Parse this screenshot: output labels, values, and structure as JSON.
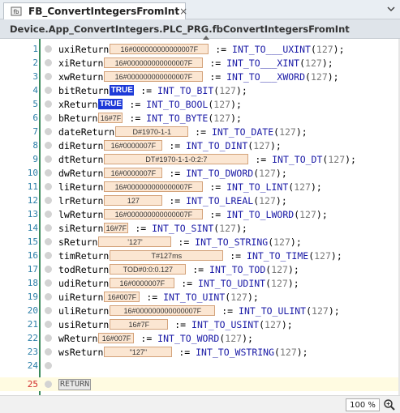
{
  "tab": {
    "title": "FB_ConvertIntegersFromInt",
    "close": "×"
  },
  "path": {
    "title": "Device.App_ConvertIntegers.PLC_PRG.fbConvertIntegersFromInt"
  },
  "lines": [
    {
      "num": "1",
      "var": "uxiReturn",
      "value": "16#000000000000007F",
      "w": 122,
      "func": "INT_TO___UXINT",
      "arg": "127"
    },
    {
      "num": "2",
      "var": "xiReturn",
      "value": "16#000000000000007F",
      "w": 122,
      "func": "INT_TO___XINT",
      "arg": "127"
    },
    {
      "num": "3",
      "var": "xwReturn",
      "value": "16#000000000000007F",
      "w": 122,
      "func": "INT_TO___XWORD",
      "arg": "127"
    },
    {
      "num": "4",
      "var": "bitReturn",
      "value": "TRUE",
      "w": 30,
      "bool": true,
      "func": "INT_TO_BIT",
      "arg": "127"
    },
    {
      "num": "5",
      "var": "xReturn",
      "value": "TRUE",
      "w": 30,
      "bool": true,
      "func": "INT_TO_BOOL",
      "arg": "127"
    },
    {
      "num": "6",
      "var": "bReturn",
      "value": "16#7F",
      "w": 30,
      "func": "INT_TO_BYTE",
      "arg": "127"
    },
    {
      "num": "7",
      "var": "dateReturn",
      "value": "D#1970-1-1",
      "w": 90,
      "func": "INT_TO_DATE",
      "arg": "127"
    },
    {
      "num": "8",
      "var": "diReturn",
      "value": "16#0000007F",
      "w": 72,
      "func": "INT_TO_DINT",
      "arg": "127"
    },
    {
      "num": "9",
      "var": "dtReturn",
      "value": "DT#1970-1-1-0:2:7",
      "w": 178,
      "func": "INT_TO_DT",
      "arg": "127"
    },
    {
      "num": "10",
      "var": "dwReturn",
      "value": "16#0000007F",
      "w": 72,
      "func": "INT_TO_DWORD",
      "arg": "127"
    },
    {
      "num": "11",
      "var": "liReturn",
      "value": "16#000000000000007F",
      "w": 122,
      "func": "INT_TO_LINT",
      "arg": "127"
    },
    {
      "num": "12",
      "var": "lrReturn",
      "value": "127",
      "w": 72,
      "func": "INT_TO_LREAL",
      "arg": "127"
    },
    {
      "num": "13",
      "var": "lwReturn",
      "value": "16#000000000000007F",
      "w": 122,
      "func": "INT_TO_LWORD",
      "arg": "127"
    },
    {
      "num": "14",
      "var": "siReturn",
      "value": "16#7F",
      "w": 30,
      "func": "INT_TO_SINT",
      "arg": "127"
    },
    {
      "num": "15",
      "var": "sReturn",
      "value": "'127'",
      "w": 90,
      "func": "INT_TO_STRING",
      "arg": "127"
    },
    {
      "num": "16",
      "var": "timReturn",
      "value": "T#127ms",
      "w": 140,
      "func": "INT_TO_TIME",
      "arg": "127"
    },
    {
      "num": "17",
      "var": "todReturn",
      "value": "TOD#0:0:0.127",
      "w": 94,
      "func": "INT_TO_TOD",
      "arg": "127"
    },
    {
      "num": "18",
      "var": "udiReturn",
      "value": "16#0000007F",
      "w": 80,
      "func": "INT_TO_UDINT",
      "arg": "127"
    },
    {
      "num": "19",
      "var": "uiReturn",
      "value": "16#007F",
      "w": 44,
      "func": "INT_TO_UINT",
      "arg": "127"
    },
    {
      "num": "20",
      "var": "uliReturn",
      "value": "16#000000000000007F",
      "w": 130,
      "func": "INT_TO_ULINT",
      "arg": "127"
    },
    {
      "num": "21",
      "var": "usiReturn",
      "value": "16#7F",
      "w": 72,
      "func": "INT_TO_USINT",
      "arg": "127"
    },
    {
      "num": "22",
      "var": "wReturn",
      "value": "16#007F",
      "w": 44,
      "func": "INT_TO_WORD",
      "arg": "127"
    },
    {
      "num": "23",
      "var": "wsReturn",
      "value": "\"127\"",
      "w": 84,
      "func": "INT_TO_WSTRING",
      "arg": "127"
    }
  ],
  "line24": {
    "num": "24"
  },
  "line25": {
    "num": "25",
    "text": "RETURN"
  },
  "status": {
    "zoom": "100 %"
  },
  "icons": {
    "tab": "function-block-icon",
    "zoom": "zoom-icon"
  },
  "colors": {
    "gutter_bar": "#3a8a5c",
    "value_box": "#fbe6d2",
    "bool_box": "#1c39d8",
    "keyword": "#1a1aa6"
  }
}
